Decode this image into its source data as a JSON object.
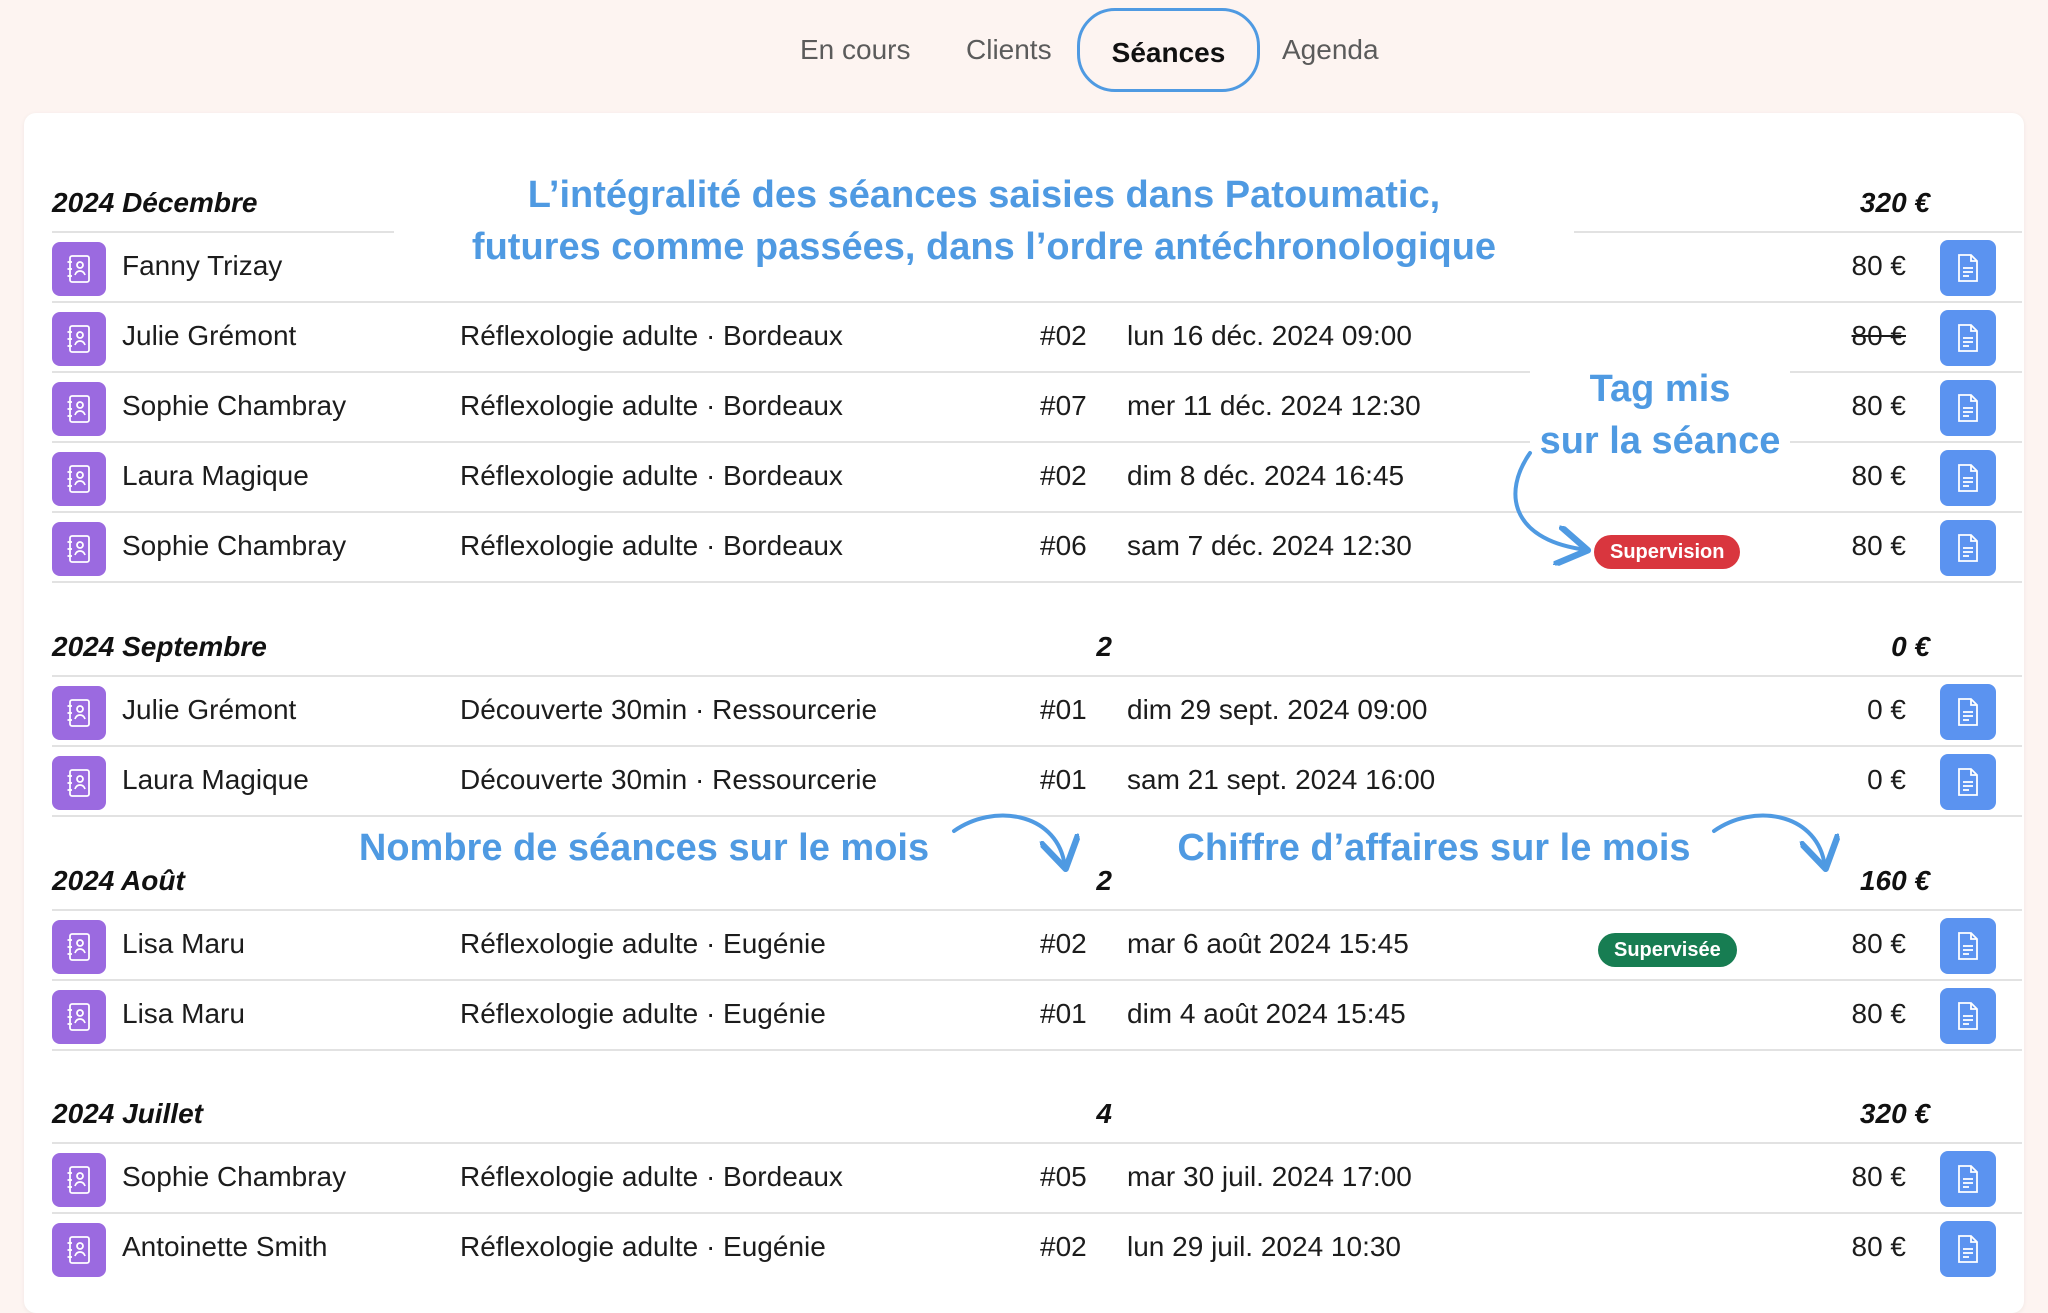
{
  "tabs": [
    {
      "label": "En cours",
      "active": false
    },
    {
      "label": "Clients",
      "active": false
    },
    {
      "label": "Séances",
      "active": true
    },
    {
      "label": "Agenda",
      "active": false
    }
  ],
  "colors": {
    "background": "#fdf4f1",
    "accent": "#4f9ae2",
    "client_icon": "#9b6ae0",
    "doc_icon": "#5b93f0",
    "tag_supervision": "#d9363e",
    "tag_supervisee": "#177d52"
  },
  "icons": {
    "client": "contact-book-icon",
    "document": "document-icon"
  },
  "annotations": {
    "intro_line1": "L’intégralité des séances saisies dans Patoumatic,",
    "intro_line2": "futures comme passées, dans l’ordre antéchronologique",
    "tag_line1": "Tag mis",
    "tag_line2": "sur la séance",
    "count": "Nombre de séances sur le mois",
    "revenue": "Chiffre d’affaires sur le mois"
  },
  "months": [
    {
      "label": "2024 Décembre",
      "count": "",
      "total": "320 €",
      "sessions": [
        {
          "client": "Fanny Trizay",
          "type": "",
          "num": "",
          "date": "",
          "tag": "",
          "price": "80 €",
          "strike": false
        },
        {
          "client": "Julie Grémont",
          "type": "Réflexologie adulte · Bordeaux",
          "num": "#02",
          "date": "lun 16 déc. 2024 09:00",
          "tag": "",
          "price": "80 €",
          "strike": true
        },
        {
          "client": "Sophie Chambray",
          "type": "Réflexologie adulte · Bordeaux",
          "num": "#07",
          "date": "mer 11 déc. 2024 12:30",
          "tag": "",
          "price": "80 €",
          "strike": false
        },
        {
          "client": "Laura Magique",
          "type": "Réflexologie adulte · Bordeaux",
          "num": "#02",
          "date": "dim 8 déc. 2024 16:45",
          "tag": "",
          "price": "80 €",
          "strike": false
        },
        {
          "client": "Sophie Chambray",
          "type": "Réflexologie adulte · Bordeaux",
          "num": "#06",
          "date": "sam 7 déc. 2024 12:30",
          "tag": "Supervision",
          "price": "80 €",
          "strike": false
        }
      ]
    },
    {
      "label": "2024 Septembre",
      "count": "2",
      "total": "0 €",
      "sessions": [
        {
          "client": "Julie Grémont",
          "type": "Découverte 30min · Ressourcerie",
          "num": "#01",
          "date": "dim 29 sept. 2024 09:00",
          "tag": "",
          "price": "0 €",
          "strike": false
        },
        {
          "client": "Laura Magique",
          "type": "Découverte 30min · Ressourcerie",
          "num": "#01",
          "date": "sam 21 sept. 2024 16:00",
          "tag": "",
          "price": "0 €",
          "strike": false
        }
      ]
    },
    {
      "label": "2024 Août",
      "count": "2",
      "total": "160 €",
      "sessions": [
        {
          "client": "Lisa Maru",
          "type": "Réflexologie adulte · Eugénie",
          "num": "#02",
          "date": "mar 6 août 2024 15:45",
          "tag": "Supervisée",
          "price": "80 €",
          "strike": false
        },
        {
          "client": "Lisa Maru",
          "type": "Réflexologie adulte · Eugénie",
          "num": "#01",
          "date": "dim 4 août 2024 15:45",
          "tag": "",
          "price": "80 €",
          "strike": false
        }
      ]
    },
    {
      "label": "2024 Juillet",
      "count": "4",
      "total": "320 €",
      "sessions": [
        {
          "client": "Sophie Chambray",
          "type": "Réflexologie adulte · Bordeaux",
          "num": "#05",
          "date": "mar 30 juil. 2024 17:00",
          "tag": "",
          "price": "80 €",
          "strike": false
        },
        {
          "client": "Antoinette Smith",
          "type": "Réflexologie adulte · Eugénie",
          "num": "#02",
          "date": "lun 29 juil. 2024 10:30",
          "tag": "",
          "price": "80 €",
          "strike": false
        }
      ]
    }
  ]
}
